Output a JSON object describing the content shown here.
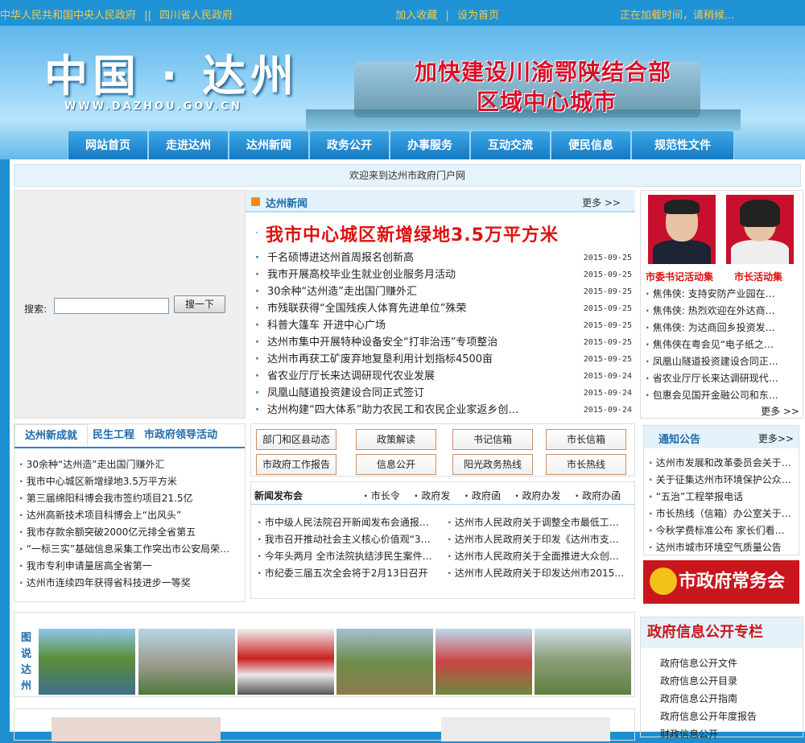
{
  "topbar": {
    "link_central": "中华人民共和国中央人民政府",
    "sep": "||",
    "link_province": "四川省人民政府",
    "favorite": "加入收藏",
    "bar": "|",
    "homepage": "设为首页",
    "clock": "正在加载时间，请稍候..."
  },
  "banner": {
    "logo": "中国 · 达州",
    "url": "WWW.DAZHOU.GOV.CN",
    "slogan_line1": "加快建设川渝鄂陕结合部",
    "slogan_line2": "区域中心城市"
  },
  "nav": [
    "网站首页",
    "走进达州",
    "达州新闻",
    "政务公开",
    "办事服务",
    "互动交流",
    "便民信息",
    "规范性文件"
  ],
  "welcome": "欢迎来到达州市政府门户网",
  "search": {
    "label": "搜索:",
    "value": "",
    "button": "搜一下"
  },
  "news": {
    "title": "达州新闻",
    "more": "更多 >>",
    "headline": "我市中心城区新增绿地3.5万平方米",
    "items": [
      {
        "title": "千名硕博进达州首周报名创新高",
        "date": "2015-09-25"
      },
      {
        "title": "我市开展高校毕业生就业创业服务月活动",
        "date": "2015-09-25"
      },
      {
        "title": "30余种“达州造”走出国门赚外汇",
        "date": "2015-09-25"
      },
      {
        "title": "市残联获得“全国残疾人体育先进单位”殊荣",
        "date": "2015-09-25"
      },
      {
        "title": "科普大篷车 开进中心广场",
        "date": "2015-09-25"
      },
      {
        "title": "达州市集中开展特种设备安全“打非治违”专项整治",
        "date": "2015-09-25"
      },
      {
        "title": "达州市再获工矿废弃地复垦利用计划指标4500亩",
        "date": "2015-09-25"
      },
      {
        "title": "省农业厅厅长来达调研现代农业发展",
        "date": "2015-09-24"
      },
      {
        "title": "凤凰山隧道投资建设合同正式签订",
        "date": "2015-09-24"
      },
      {
        "title": "达州构建“四大体系”助力农民工和农民企业家返乡创…",
        "date": "2015-09-24"
      }
    ]
  },
  "leaders": {
    "caption_secretary": "市委书记活动集",
    "caption_mayor": "市长活动集",
    "items": [
      "焦伟侠: 支持安防产业园在…",
      "焦伟侠: 热烈欢迎在外达商…",
      "焦伟侠: 为达商回乡投资发…",
      "焦伟侠在粤会见“电子纸之…",
      "凤凰山隧道投资建设合同正…",
      "省农业厅厅长来达调研现代…",
      "包惠会见国开金融公司和东…"
    ],
    "more": "更多 >>"
  },
  "tabs": {
    "labels": [
      "达州新成就",
      "民生工程",
      "市政府领导活动"
    ],
    "items": [
      "30余种“达州造”走出国门赚外汇",
      "我市中心城区新增绿地3.5万平方米",
      "第三届绵阳科博会我市签约项目21.5亿",
      "达州高新技术项目科博会上“出风头”",
      "我市存款余额突破2000亿元排全省第五",
      "“一标三实”基础信息采集工作突出市公安局荣…",
      "我市专利申请量居高全省第一",
      "达州市连续四年获得省科技进步一等奖"
    ]
  },
  "buttons": [
    "部门和区县动态",
    "政策解读",
    "书记信箱",
    "市长信箱",
    "市政府工作报告",
    "信息公开",
    "阳光政务热线",
    "市长热线"
  ],
  "press": {
    "title": "新闻发布会",
    "subtabs": [
      "市长令",
      "政府发",
      "政府函",
      "政府办发",
      "政府办函"
    ],
    "left": [
      "市中级人民法院召开新闻发布会通报…",
      "我市召开推动社会主义核心价值观“3…",
      "今年头两月 全市法院执结涉民生案件…",
      "市纪委三届五次全会将于2月13日召开"
    ],
    "right": [
      "达州市人民政府关于调整全市最低工…",
      "达州市人民政府关于印发《达州市支…",
      "达州市人民政府关于全面推进大众创…",
      "达州市人民政府关于印发达州市2015…"
    ]
  },
  "notice": {
    "title": "通知公告",
    "more": "更多>>",
    "items": [
      "达州市发展和改革委员会关于…",
      "关于征集达州市环境保护公众…",
      "“五治”工程举报电话",
      "市长热线（信箱）办公室关于…",
      "今秋学费标准公布 家长们看…",
      "达州市城市环境空气质量公告"
    ]
  },
  "meeting": "市政府常务会议",
  "gallery": {
    "title": "图说达州"
  },
  "gov_info": {
    "title": "政府信息公开专栏",
    "items": [
      "政府信息公开文件",
      "政府信息公开目录",
      "政府信息公开指南",
      "政府信息公开年度报告",
      "财政信息公开"
    ]
  }
}
